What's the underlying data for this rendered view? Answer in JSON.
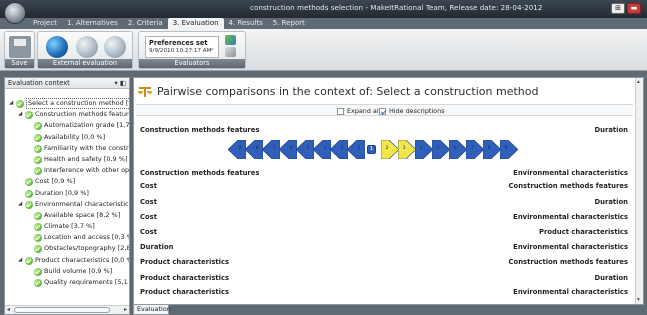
{
  "window": {
    "title": "construction methods selection - MakeItRational Team, Release date: 28-04-2012",
    "buttons": [
      {
        "label": "⊞"
      },
      {
        "label": "▬"
      }
    ]
  },
  "tabs": [
    {
      "label": "Project"
    },
    {
      "label": "1. Alternatives"
    },
    {
      "label": "2. Criteria"
    },
    {
      "label": "3. Evaluation",
      "active": true
    },
    {
      "label": "4. Results"
    },
    {
      "label": "5. Report"
    }
  ],
  "ribbon": {
    "save_group": "Save",
    "external_group": "External evaluation",
    "evaluators_group": "Evaluators",
    "preferences_set": "Preferences set",
    "preferences_date": "9/9/2010 10:27:17 AM"
  },
  "left_panel": {
    "title": "Evaluation context",
    "tree": [
      {
        "label": "Select a construction method [9",
        "level": 0,
        "expanded": true,
        "selected": true
      },
      {
        "label": "Construction methods feature",
        "level": 1,
        "expanded": true
      },
      {
        "label": "Automatization grade [1,7",
        "level": 2
      },
      {
        "label": "Availability [0,0 %]",
        "level": 2
      },
      {
        "label": "Familiarity with the constru",
        "level": 2
      },
      {
        "label": "Health and safety [0,9 %]",
        "level": 2
      },
      {
        "label": "Interference with other ope",
        "level": 2
      },
      {
        "label": "Cost [0,9 %]",
        "level": 1
      },
      {
        "label": "Duration [0,9 %]",
        "level": 1
      },
      {
        "label": "Environmental characteristics",
        "level": 1,
        "expanded": true
      },
      {
        "label": "Available space [8,2 %]",
        "level": 2
      },
      {
        "label": "Climate [3,7 %]",
        "level": 2
      },
      {
        "label": "Location and access [0,3 %",
        "level": 2
      },
      {
        "label": "Obstacles/topography [2,8",
        "level": 2
      },
      {
        "label": "Product characteristics [0,0 %",
        "level": 1,
        "expanded": true
      },
      {
        "label": "Build volume [0,9 %]",
        "level": 2
      },
      {
        "label": "Quality requirements [5,1",
        "level": 2
      }
    ]
  },
  "main": {
    "title": "Pairwise comparisons in the context of: Select a construction method",
    "expand_all": "Expand all",
    "hide_descriptions": "Hide descriptions",
    "scale_left": [
      "9",
      "8",
      "7",
      "6",
      "5",
      "4",
      "3",
      "2"
    ],
    "scale_mid": "1",
    "scale_right": [
      "2",
      "3",
      "4",
      "5",
      "6",
      "7",
      "8",
      "9"
    ],
    "selected_value": "3",
    "comparisons": [
      {
        "left": "Construction methods features",
        "right": "Duration"
      },
      {
        "left": "Construction methods features",
        "right": "Environmental characteristics"
      },
      {
        "left": "Cost",
        "right": "Construction methods features"
      },
      {
        "left": "Cost",
        "right": "Duration"
      },
      {
        "left": "Cost",
        "right": "Environmental characteristics"
      },
      {
        "left": "Cost",
        "right": "Product characteristics"
      },
      {
        "left": "Duration",
        "right": "Environmental characteristics"
      },
      {
        "left": "Product characteristics",
        "right": "Construction methods features"
      },
      {
        "left": "Product characteristics",
        "right": "Duration"
      },
      {
        "left": "Product characteristics",
        "right": "Environmental characteristics"
      }
    ]
  },
  "bottom_tab": "Evaluation",
  "colors": {
    "arrow_blue": "#2f5fb9",
    "arrow_yellow": "#f2e64b",
    "check_green": "#3e9b1d"
  },
  "icons": [
    "save-icon",
    "globe-icon",
    "scales-icon",
    "person-icon",
    "check-icon"
  ]
}
